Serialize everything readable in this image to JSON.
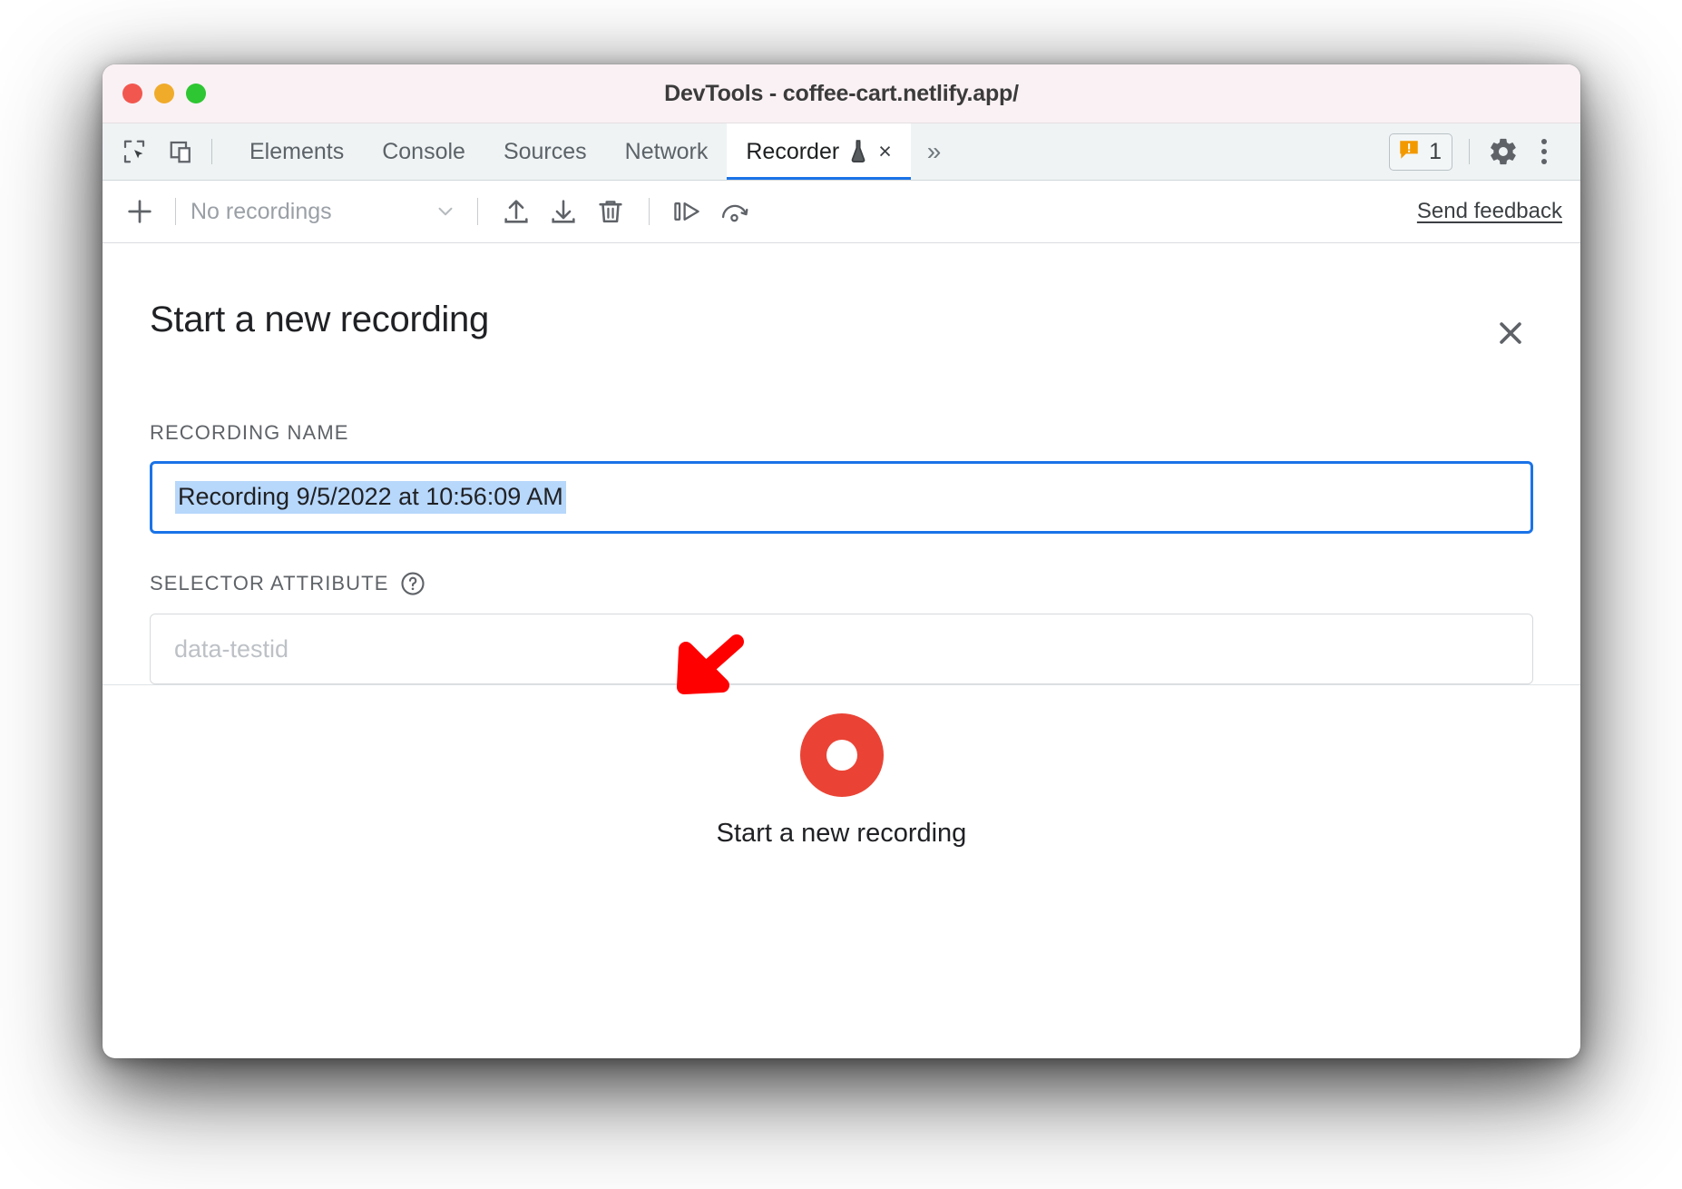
{
  "window": {
    "title": "DevTools - coffee-cart.netlify.app/",
    "traffic_lights": [
      "close",
      "minimize",
      "zoom"
    ]
  },
  "devtools": {
    "left_icons": [
      {
        "name": "inspect-element-icon",
        "label": "Inspect element"
      },
      {
        "name": "device-toolbar-icon",
        "label": "Toggle device toolbar"
      }
    ],
    "tabs": [
      {
        "label": "Elements",
        "active": false
      },
      {
        "label": "Console",
        "active": false
      },
      {
        "label": "Sources",
        "active": false
      },
      {
        "label": "Network",
        "active": false
      },
      {
        "label": "Recorder",
        "active": true,
        "experimental": true,
        "closable": true
      }
    ],
    "more_tabs_label": "»",
    "tab_close_label": "×",
    "warnings": {
      "count": "1",
      "icon": "warning-icon",
      "color": "#f29900"
    },
    "settings_icon_label": "Settings",
    "kebab_label": "Customize and control DevTools"
  },
  "recorder_toolbar": {
    "add_label": "+",
    "recordings_select": {
      "value": "No recordings",
      "chevron": "⌄"
    },
    "buttons": [
      {
        "name": "import-recording-button",
        "label": "Import recording"
      },
      {
        "name": "export-recording-button",
        "label": "Export recording"
      },
      {
        "name": "delete-recording-button",
        "label": "Delete recording"
      },
      {
        "name": "replay-step-button",
        "label": "Replay step by step"
      },
      {
        "name": "replay-speed-button",
        "label": "Replay speed"
      }
    ],
    "feedback_label": "Send feedback"
  },
  "panel": {
    "title": "Start a new recording",
    "close_label": "✕",
    "recording_name": {
      "label": "RECORDING NAME",
      "value": "Recording 9/5/2022 at 10:56:09 AM",
      "selected": true,
      "focused": true,
      "selection_color": "#b7d7fb",
      "focus_border_color": "#1a73e8"
    },
    "selector_attribute": {
      "label": "SELECTOR ATTRIBUTE",
      "help_icon": "help-icon",
      "value": "",
      "placeholder": "data-testid"
    },
    "start_button": {
      "label": "Start a new recording",
      "color": "#ea4335",
      "icon": "record-circle-icon"
    }
  },
  "annotation": {
    "arrow": {
      "name": "red-pointer-arrow",
      "color": "#ff0000",
      "points_to": "recording-name-input"
    }
  }
}
